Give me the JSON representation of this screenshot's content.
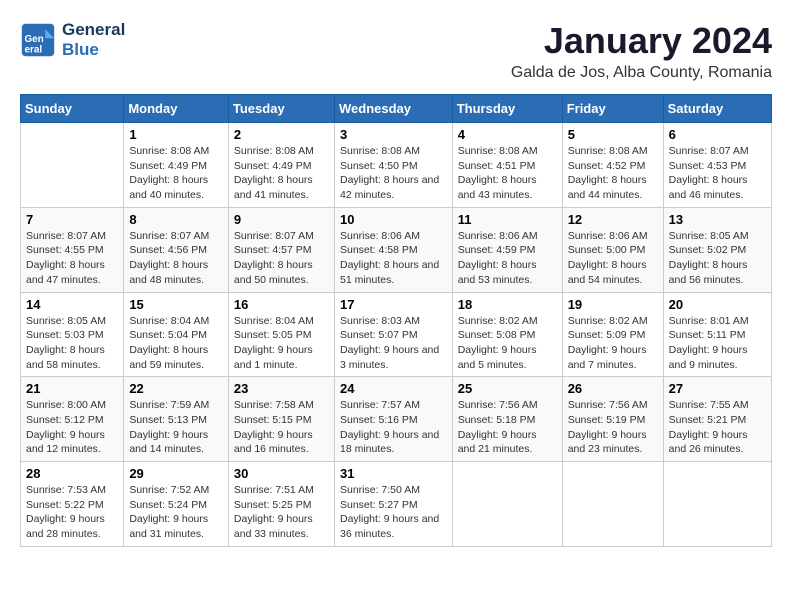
{
  "header": {
    "logo_line1": "General",
    "logo_line2": "Blue",
    "title": "January 2024",
    "subtitle": "Galda de Jos, Alba County, Romania"
  },
  "weekdays": [
    "Sunday",
    "Monday",
    "Tuesday",
    "Wednesday",
    "Thursday",
    "Friday",
    "Saturday"
  ],
  "weeks": [
    [
      {
        "day": "",
        "sunrise": "",
        "sunset": "",
        "daylight": ""
      },
      {
        "day": "1",
        "sunrise": "Sunrise: 8:08 AM",
        "sunset": "Sunset: 4:49 PM",
        "daylight": "Daylight: 8 hours and 40 minutes."
      },
      {
        "day": "2",
        "sunrise": "Sunrise: 8:08 AM",
        "sunset": "Sunset: 4:49 PM",
        "daylight": "Daylight: 8 hours and 41 minutes."
      },
      {
        "day": "3",
        "sunrise": "Sunrise: 8:08 AM",
        "sunset": "Sunset: 4:50 PM",
        "daylight": "Daylight: 8 hours and 42 minutes."
      },
      {
        "day": "4",
        "sunrise": "Sunrise: 8:08 AM",
        "sunset": "Sunset: 4:51 PM",
        "daylight": "Daylight: 8 hours and 43 minutes."
      },
      {
        "day": "5",
        "sunrise": "Sunrise: 8:08 AM",
        "sunset": "Sunset: 4:52 PM",
        "daylight": "Daylight: 8 hours and 44 minutes."
      },
      {
        "day": "6",
        "sunrise": "Sunrise: 8:07 AM",
        "sunset": "Sunset: 4:53 PM",
        "daylight": "Daylight: 8 hours and 46 minutes."
      }
    ],
    [
      {
        "day": "7",
        "sunrise": "Sunrise: 8:07 AM",
        "sunset": "Sunset: 4:55 PM",
        "daylight": "Daylight: 8 hours and 47 minutes."
      },
      {
        "day": "8",
        "sunrise": "Sunrise: 8:07 AM",
        "sunset": "Sunset: 4:56 PM",
        "daylight": "Daylight: 8 hours and 48 minutes."
      },
      {
        "day": "9",
        "sunrise": "Sunrise: 8:07 AM",
        "sunset": "Sunset: 4:57 PM",
        "daylight": "Daylight: 8 hours and 50 minutes."
      },
      {
        "day": "10",
        "sunrise": "Sunrise: 8:06 AM",
        "sunset": "Sunset: 4:58 PM",
        "daylight": "Daylight: 8 hours and 51 minutes."
      },
      {
        "day": "11",
        "sunrise": "Sunrise: 8:06 AM",
        "sunset": "Sunset: 4:59 PM",
        "daylight": "Daylight: 8 hours and 53 minutes."
      },
      {
        "day": "12",
        "sunrise": "Sunrise: 8:06 AM",
        "sunset": "Sunset: 5:00 PM",
        "daylight": "Daylight: 8 hours and 54 minutes."
      },
      {
        "day": "13",
        "sunrise": "Sunrise: 8:05 AM",
        "sunset": "Sunset: 5:02 PM",
        "daylight": "Daylight: 8 hours and 56 minutes."
      }
    ],
    [
      {
        "day": "14",
        "sunrise": "Sunrise: 8:05 AM",
        "sunset": "Sunset: 5:03 PM",
        "daylight": "Daylight: 8 hours and 58 minutes."
      },
      {
        "day": "15",
        "sunrise": "Sunrise: 8:04 AM",
        "sunset": "Sunset: 5:04 PM",
        "daylight": "Daylight: 8 hours and 59 minutes."
      },
      {
        "day": "16",
        "sunrise": "Sunrise: 8:04 AM",
        "sunset": "Sunset: 5:05 PM",
        "daylight": "Daylight: 9 hours and 1 minute."
      },
      {
        "day": "17",
        "sunrise": "Sunrise: 8:03 AM",
        "sunset": "Sunset: 5:07 PM",
        "daylight": "Daylight: 9 hours and 3 minutes."
      },
      {
        "day": "18",
        "sunrise": "Sunrise: 8:02 AM",
        "sunset": "Sunset: 5:08 PM",
        "daylight": "Daylight: 9 hours and 5 minutes."
      },
      {
        "day": "19",
        "sunrise": "Sunrise: 8:02 AM",
        "sunset": "Sunset: 5:09 PM",
        "daylight": "Daylight: 9 hours and 7 minutes."
      },
      {
        "day": "20",
        "sunrise": "Sunrise: 8:01 AM",
        "sunset": "Sunset: 5:11 PM",
        "daylight": "Daylight: 9 hours and 9 minutes."
      }
    ],
    [
      {
        "day": "21",
        "sunrise": "Sunrise: 8:00 AM",
        "sunset": "Sunset: 5:12 PM",
        "daylight": "Daylight: 9 hours and 12 minutes."
      },
      {
        "day": "22",
        "sunrise": "Sunrise: 7:59 AM",
        "sunset": "Sunset: 5:13 PM",
        "daylight": "Daylight: 9 hours and 14 minutes."
      },
      {
        "day": "23",
        "sunrise": "Sunrise: 7:58 AM",
        "sunset": "Sunset: 5:15 PM",
        "daylight": "Daylight: 9 hours and 16 minutes."
      },
      {
        "day": "24",
        "sunrise": "Sunrise: 7:57 AM",
        "sunset": "Sunset: 5:16 PM",
        "daylight": "Daylight: 9 hours and 18 minutes."
      },
      {
        "day": "25",
        "sunrise": "Sunrise: 7:56 AM",
        "sunset": "Sunset: 5:18 PM",
        "daylight": "Daylight: 9 hours and 21 minutes."
      },
      {
        "day": "26",
        "sunrise": "Sunrise: 7:56 AM",
        "sunset": "Sunset: 5:19 PM",
        "daylight": "Daylight: 9 hours and 23 minutes."
      },
      {
        "day": "27",
        "sunrise": "Sunrise: 7:55 AM",
        "sunset": "Sunset: 5:21 PM",
        "daylight": "Daylight: 9 hours and 26 minutes."
      }
    ],
    [
      {
        "day": "28",
        "sunrise": "Sunrise: 7:53 AM",
        "sunset": "Sunset: 5:22 PM",
        "daylight": "Daylight: 9 hours and 28 minutes."
      },
      {
        "day": "29",
        "sunrise": "Sunrise: 7:52 AM",
        "sunset": "Sunset: 5:24 PM",
        "daylight": "Daylight: 9 hours and 31 minutes."
      },
      {
        "day": "30",
        "sunrise": "Sunrise: 7:51 AM",
        "sunset": "Sunset: 5:25 PM",
        "daylight": "Daylight: 9 hours and 33 minutes."
      },
      {
        "day": "31",
        "sunrise": "Sunrise: 7:50 AM",
        "sunset": "Sunset: 5:27 PM",
        "daylight": "Daylight: 9 hours and 36 minutes."
      },
      {
        "day": "",
        "sunrise": "",
        "sunset": "",
        "daylight": ""
      },
      {
        "day": "",
        "sunrise": "",
        "sunset": "",
        "daylight": ""
      },
      {
        "day": "",
        "sunrise": "",
        "sunset": "",
        "daylight": ""
      }
    ]
  ]
}
